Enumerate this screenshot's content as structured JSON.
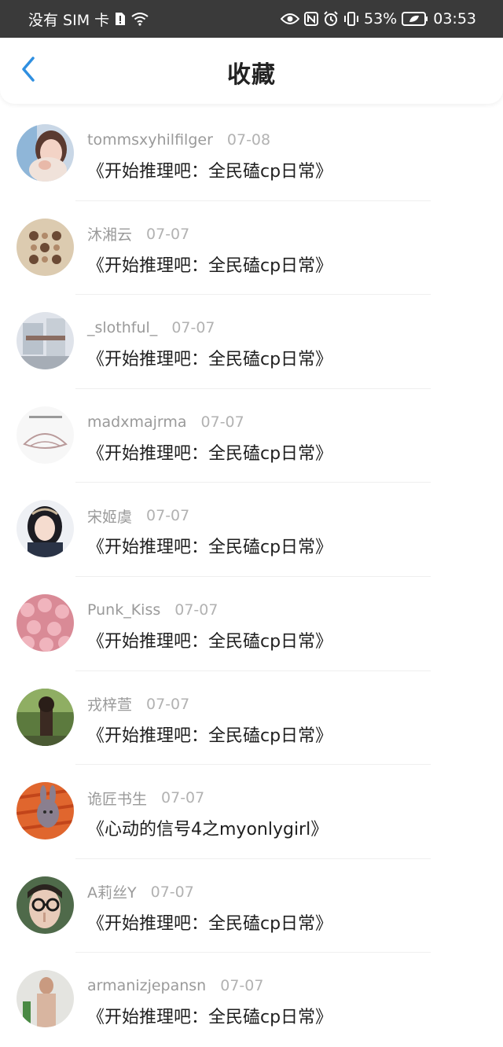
{
  "status_bar": {
    "carrier": "没有 SIM 卡",
    "battery": "53%",
    "time": "03:53"
  },
  "header": {
    "title": "收藏"
  },
  "items": [
    {
      "username": "tommsxyhilfilger",
      "date": "07-08",
      "title": "《开始推理吧：全民磕cp日常》"
    },
    {
      "username": "沐湘云",
      "date": "07-07",
      "title": "《开始推理吧：全民磕cp日常》"
    },
    {
      "username": "_slothful_",
      "date": "07-07",
      "title": "《开始推理吧：全民磕cp日常》"
    },
    {
      "username": "madxmajrma",
      "date": "07-07",
      "title": "《开始推理吧：全民磕cp日常》"
    },
    {
      "username": "宋姬虞",
      "date": "07-07",
      "title": "《开始推理吧：全民磕cp日常》"
    },
    {
      "username": "Punk_Kiss",
      "date": "07-07",
      "title": "《开始推理吧：全民磕cp日常》"
    },
    {
      "username": "戎梓萱",
      "date": "07-07",
      "title": "《开始推理吧：全民磕cp日常》"
    },
    {
      "username": "诡匠书生",
      "date": "07-07",
      "title": "《心动的信号4之myonlygirl》"
    },
    {
      "username": "A莉丝Y",
      "date": "07-07",
      "title": "《开始推理吧：全民磕cp日常》"
    },
    {
      "username": "armanizjepansn",
      "date": "07-07",
      "title": "《开始推理吧：全民磕cp日常》"
    }
  ],
  "colors": {
    "accent": "#2f8fe0",
    "status_bar_bg": "#3a3a3a",
    "meta_text": "#9a9a9a",
    "title_text": "#1f1f1f"
  }
}
